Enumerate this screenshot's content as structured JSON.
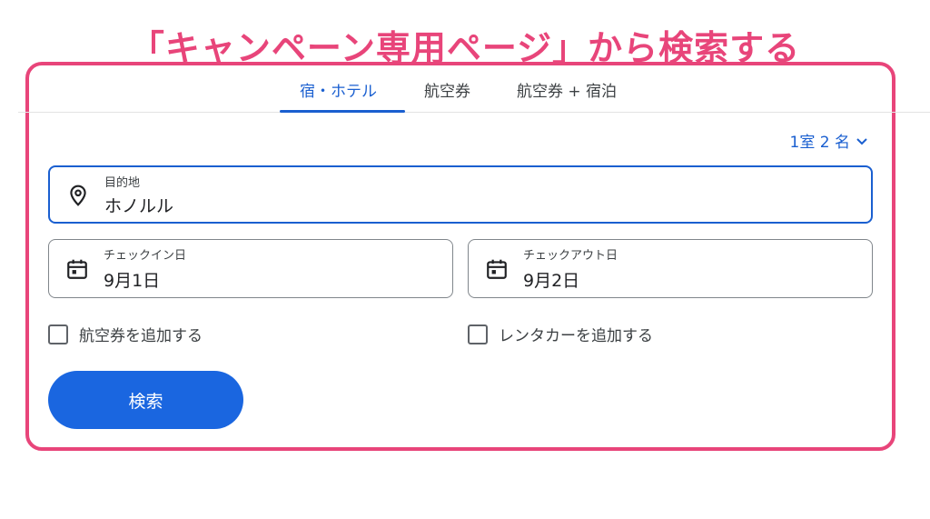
{
  "headline": "「キャンペーン専用ページ」から検索する",
  "tabs": [
    {
      "label": "宿・ホテル",
      "active": true
    },
    {
      "label": "航空券",
      "active": false
    },
    {
      "label": "航空券 + 宿泊",
      "active": false
    }
  ],
  "guests": {
    "label": "1室 2 名",
    "icon": "chevron-down-icon"
  },
  "destination": {
    "label": "目的地",
    "value": "ホノルル",
    "icon": "location-pin-icon"
  },
  "checkin": {
    "label": "チェックイン日",
    "value": "9月1日",
    "icon": "calendar-icon"
  },
  "checkout": {
    "label": "チェックアウト日",
    "value": "9月2日",
    "icon": "calendar-icon"
  },
  "options": {
    "add_flight": "航空券を追加する",
    "add_car": "レンタカーを追加する"
  },
  "search_button": "検索",
  "colors": {
    "accent": "#1a66e0",
    "annotation": "#e8457a"
  }
}
